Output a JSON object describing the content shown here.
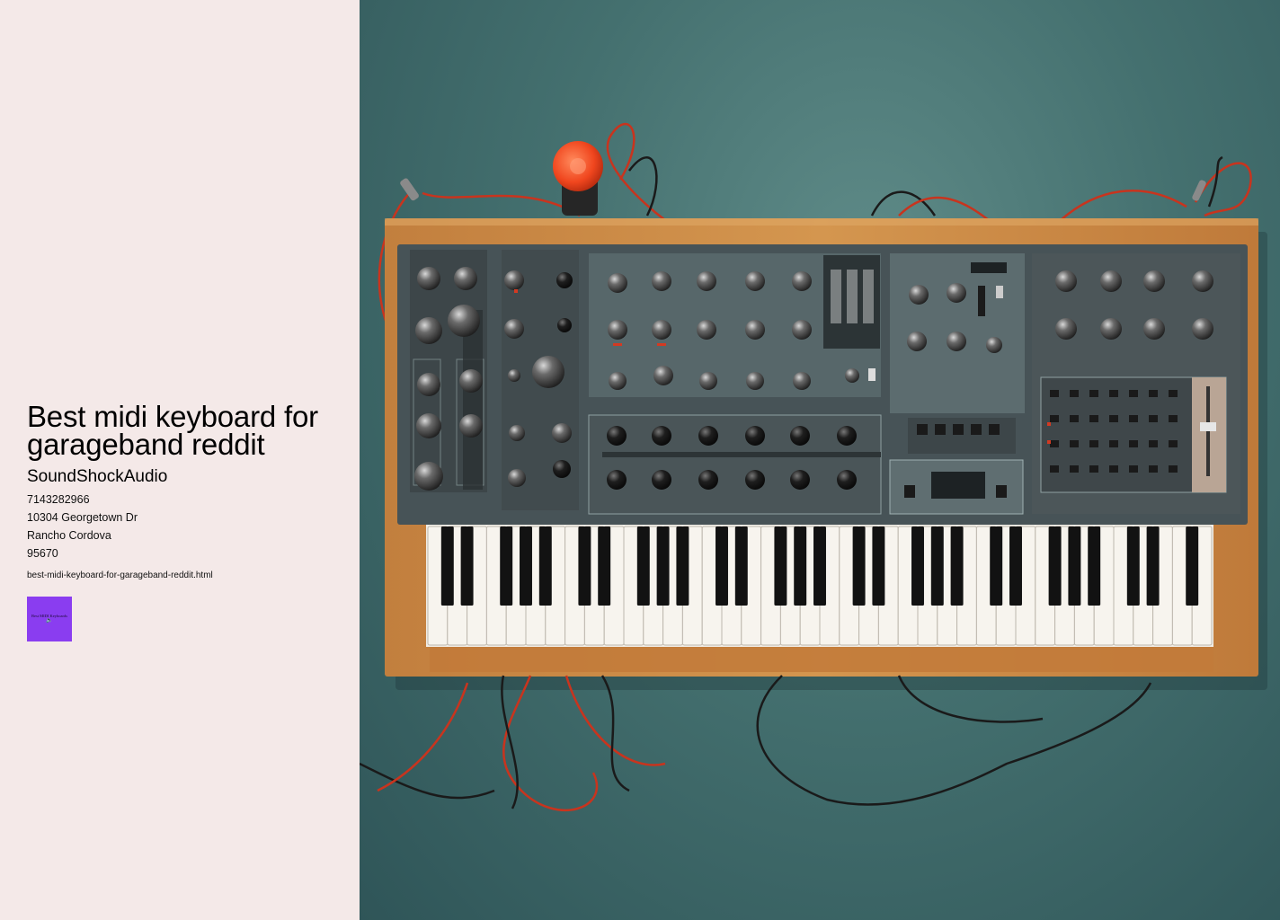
{
  "page": {
    "title": "Best midi keyboard for garageband reddit",
    "company": "SoundShockAudio",
    "phone": "7143282966",
    "address": "10304 Georgetown Dr",
    "city": "Rancho Cordova",
    "zip": "95670",
    "filename": "best-midi-keyboard-for-garageband-reddit.html"
  },
  "thumbnail": {
    "caption": "Best MIDI Keyboards",
    "icon": "speaker-icon",
    "color": "#8a3df0"
  },
  "hero_image": {
    "subject": "synthesizer-keyboard",
    "background_color": "#4c7574",
    "panel_color": "#4a5457",
    "wood_color": "#c98a4b"
  }
}
